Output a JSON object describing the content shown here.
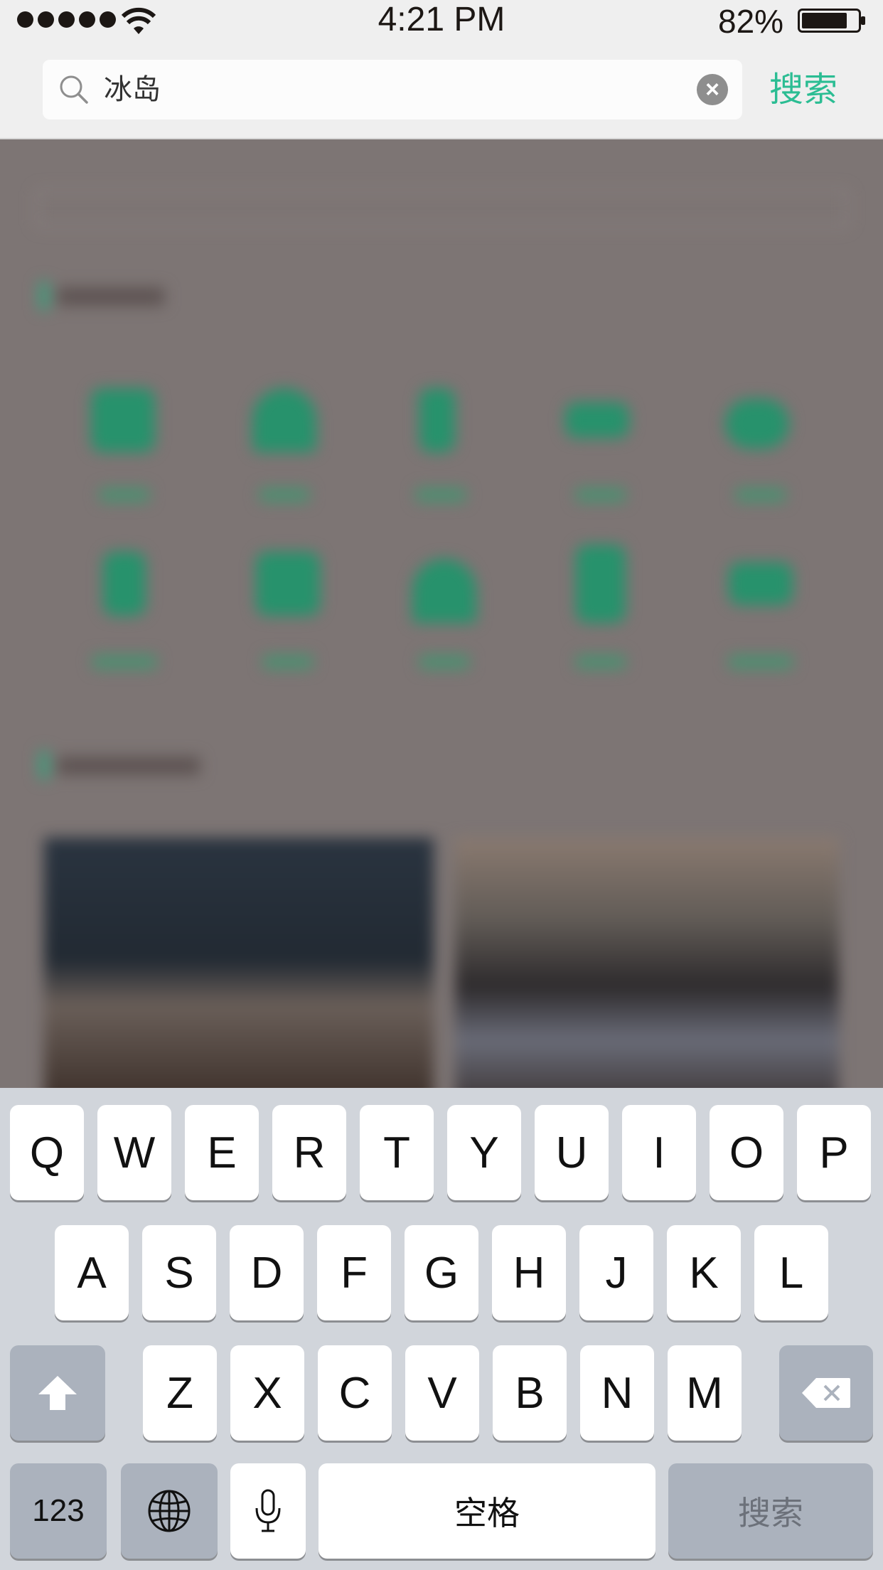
{
  "status_bar": {
    "time": "4:21 PM",
    "battery_percent": "82%",
    "signal_bars": 5,
    "battery_level": 0.82
  },
  "search": {
    "query": "冰岛",
    "submit_label": "搜索",
    "clear_icon": "close-icon",
    "accent_color": "#2bbd93"
  },
  "keyboard": {
    "row1": [
      "Q",
      "W",
      "E",
      "R",
      "T",
      "Y",
      "U",
      "I",
      "O",
      "P"
    ],
    "row2": [
      "A",
      "S",
      "D",
      "F",
      "G",
      "H",
      "J",
      "K",
      "L"
    ],
    "row3": [
      "Z",
      "X",
      "C",
      "V",
      "B",
      "N",
      "M"
    ],
    "numbers_label": "123",
    "space_label": "空格",
    "return_label": "搜索",
    "shift_icon": "shift-arrow-icon",
    "delete_icon": "backspace-icon",
    "globe_icon": "globe-icon",
    "mic_icon": "microphone-icon"
  }
}
